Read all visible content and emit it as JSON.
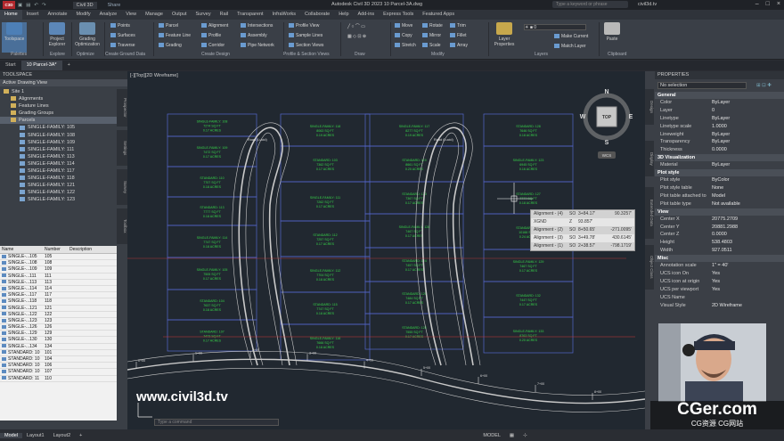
{
  "app": {
    "title": "Autodesk Civil 3D 2023    10 Parcel-3A.dwg",
    "workspace": "Civil 3D",
    "share": "Share",
    "search_placeholder": "Type a keyword or phrase",
    "user": "civil3d.tv"
  },
  "ribbon_tabs": [
    "Home",
    "Insert",
    "Annotate",
    "Modify",
    "Analyze",
    "View",
    "Manage",
    "Output",
    "Survey",
    "Rail",
    "Transparent",
    "InfraWorks",
    "Collaborate",
    "Help",
    "Add-ins",
    "Express Tools",
    "Featured Apps"
  ],
  "ribbon": {
    "toolspace": "Toolspace",
    "project_explorer": "Project Explorer",
    "grading_opt": "Grading Optimization",
    "points": "Points",
    "surfaces": "Surfaces",
    "traverse": "Traverse",
    "parcel": "Parcel",
    "feature_line": "Feature Line",
    "grading": "Grading",
    "alignment": "Alignment",
    "profile": "Profile",
    "corridor": "Corridor",
    "intersections": "Intersections",
    "assembly": "Assembly",
    "pipe_network": "Pipe Network",
    "profile_view": "Profile View",
    "sample_lines": "Sample Lines",
    "section_views": "Section Views",
    "move": "Move",
    "copy": "Copy",
    "stretch": "Stretch",
    "rotate": "Rotate",
    "mirror": "Mirror",
    "scale": "Scale",
    "trim": "Trim",
    "fillet": "Fillet",
    "array": "Array",
    "layer_properties": "Layer Properties",
    "make_current": "Make Current",
    "match_layer": "Match Layer",
    "paste": "Paste",
    "panels": [
      "Palettes",
      "Explore",
      "Optimize",
      "Create Ground Data",
      "Create Design",
      "Profile & Section Views",
      "Draw",
      "Modify",
      "Layers",
      "Clipboard"
    ]
  },
  "doc_tabs": [
    "Start",
    "10 Parcel-3A*"
  ],
  "toolspace": {
    "title": "TOOLSPACE",
    "view": "Active Drawing View",
    "tree": [
      "Site 1",
      "Alignments",
      "Feature Lines",
      "Grading Groups",
      "Parcels",
      "SINGLE-FAMILY: 105",
      "SINGLE-FAMILY: 108",
      "SINGLE-FAMILY: 109",
      "SINGLE-FAMILY: 111",
      "SINGLE-FAMILY: 113",
      "SINGLE-FAMILY: 114",
      "SINGLE-FAMILY: 117",
      "SINGLE-FAMILY: 118",
      "SINGLE-FAMILY: 121",
      "SINGLE-FAMILY: 122",
      "SINGLE-FAMILY: 123"
    ],
    "side_tabs": [
      "Prospector",
      "Settings",
      "Survey",
      "Toolbox"
    ]
  },
  "list": {
    "headers": [
      "Name",
      "Number",
      "Description"
    ],
    "rows": [
      [
        "SINGLE-...105",
        "105"
      ],
      [
        "SINGLE-...108",
        "108"
      ],
      [
        "SINGLE-...109",
        "109"
      ],
      [
        "SINGLE-...111",
        "111"
      ],
      [
        "SINGLE-...113",
        "113"
      ],
      [
        "SINGLE-...114",
        "114"
      ],
      [
        "SINGLE-...117",
        "117"
      ],
      [
        "SINGLE-...118",
        "118"
      ],
      [
        "SINGLE-...121",
        "121"
      ],
      [
        "SINGLE-...122",
        "122"
      ],
      [
        "SINGLE-...123",
        "123"
      ],
      [
        "SINGLE-...126",
        "126"
      ],
      [
        "SINGLE-...129",
        "129"
      ],
      [
        "SINGLE-...130",
        "130"
      ],
      [
        "SINGLE-...134",
        "134"
      ],
      [
        "STANDARD: 10",
        "101"
      ],
      [
        "STANDARD: 10",
        "104"
      ],
      [
        "STANDARD: 10",
        "106"
      ],
      [
        "STANDARD: 10",
        "107"
      ],
      [
        "STANDARD: 11",
        "110"
      ]
    ]
  },
  "viewport": {
    "label": "[-][Top][2D Wireframe]",
    "compass": {
      "n": "N",
      "s": "S",
      "e": "E",
      "w": "W",
      "top": "TOP"
    },
    "ucs": "WCS",
    "command_placeholder": "Type a command",
    "tooltip": [
      [
        "Alignment - (4)",
        "SO",
        "3+84.17'",
        "90.3257'"
      ],
      [
        "XGND",
        "Z",
        "93.857'",
        ""
      ],
      [
        "Alignment - (2)",
        "SO",
        "8+50.65'",
        "-271.0095'"
      ],
      [
        "Alignment - (3)",
        "SO",
        "3+49.78'",
        "430.6145'"
      ],
      [
        "Alignment - (1)",
        "SO",
        "2+38.57'",
        "-798.1719'"
      ]
    ]
  },
  "parcels": [
    {
      "l1": "SINGLE-FAMILY: 108",
      "l2": "7274 SQ FT",
      "l3": "0.17 ACRES"
    },
    {
      "l1": "SINGLE-FAMILY: 109",
      "l2": "7472 SQ FT",
      "l3": "0.17 ACRES"
    },
    {
      "l1": "STANDARD: 110",
      "l2": "7707 SQ FT",
      "l3": "0.18 ACRES"
    },
    {
      "l1": "STANDARD: 113",
      "l2": "7777 SQ FT",
      "l3": "0.18 ACRES"
    },
    {
      "l1": "SINGLE-FAMILY: 114",
      "l2": "7747 SQ FT",
      "l3": "0.18 ACRES"
    },
    {
      "l1": "SINGLE-FAMILY: 105",
      "l2": "7505 SQ FT",
      "l3": "0.17 ACRES"
    },
    {
      "l1": "STANDARD: 104",
      "l2": "7637 SQ FT",
      "l3": "0.18 ACRES"
    },
    {
      "l1": "STANDARD: 107",
      "l2": "7473 SQ FT",
      "l3": "0.17 ACRES"
    },
    {
      "l1": "SINGLE-FAMILY: 118",
      "l2": "8063 SQ FT",
      "l3": "0.19 ACRES"
    },
    {
      "l1": "STANDARD: 103",
      "l2": "7362 SQ FT",
      "l3": "0.17 ACRES"
    },
    {
      "l1": "SINGLE-FAMILY: 111",
      "l2": "7262 SQ FT",
      "l3": "0.17 ACRES"
    },
    {
      "l1": "STANDARD: 112",
      "l2": "7257 SQ FT",
      "l3": "0.17 ACRES"
    },
    {
      "l1": "SINGLE-FAMILY: 112",
      "l2": "7704 SQ FT",
      "l3": "0.18 ACRES"
    },
    {
      "l1": "STANDARD: 115",
      "l2": "7747 SQ FT",
      "l3": "0.18 ACRES"
    },
    {
      "l1": "SINGLE-FAMILY: 116",
      "l2": "7666 SQ FT",
      "l3": "0.18 ACRES"
    },
    {
      "l1": "SINGLE-FAMILY: 117",
      "l2": "8277 SQ FT",
      "l3": "0.19 ACRES"
    },
    {
      "l1": "STANDARD: 119",
      "l2": "8661 SQ FT",
      "l3": "0.20 ACRES"
    },
    {
      "l1": "STANDARD: 130",
      "l2": "7367 SQ FT",
      "l3": "0.17 ACRES"
    },
    {
      "l1": "SINGLE-FAMILY: 126",
      "l2": "7467 SQ FT",
      "l3": "0.17 ACRES"
    },
    {
      "l1": "STANDARD: 124",
      "l2": "7457 SQ FT",
      "l3": "0.17 ACRES"
    },
    {
      "l1": "STANDARD: 120",
      "l2": "7484 SQ FT",
      "l3": "0.17 ACRES"
    },
    {
      "l1": "STANDARD: 125",
      "l2": "7555 SQ FT",
      "l3": "0.17 ACRES"
    },
    {
      "l1": "STANDARD: 128",
      "l2": "7646 SQ FT",
      "l3": "0.18 ACRES"
    },
    {
      "l1": "SINGLE-FAMILY: 123",
      "l2": "6945 SQ FT",
      "l3": "0.16 ACRES"
    },
    {
      "l1": "STANDARD: 127",
      "l2": "7777 SQ FT",
      "l3": "0.18 ACRES"
    },
    {
      "l1": "STANDARD: 131",
      "l2": "10166 SQ FT",
      "l3": "0.24 ACRES"
    },
    {
      "l1": "SINGLE-FAMILY: 129",
      "l2": "7467 SQ FT",
      "l3": "0.17 ACRES"
    },
    {
      "l1": "STANDARD: 132",
      "l2": "7447 SQ FT",
      "l3": "0.17 ACRES"
    },
    {
      "l1": "SINGLE-FAMILY: 133",
      "l2": "8763 SQ FT",
      "l3": "0.20 ACRES"
    },
    {
      "l1": "STANDARD: 133",
      "l2": "7507 SQ FT",
      "l3": "0.17 ACRES"
    },
    {
      "l1": "STANDARD: 134",
      "l2": "7347 SQ FT",
      "l3": "0.17 ACRES"
    },
    {
      "l1": "STANDARD: 135",
      "l2": "7340 SQ FT",
      "l3": "0.17 ACRES"
    },
    {
      "l1": "STANDARD: 137",
      "l2": "7337 SQ FT",
      "l3": "0.17 ACRES"
    },
    {
      "l1": "SINGLE-FAMILY: 134",
      "l2": "8340 SQ FT",
      "l3": "0.19 ACRES"
    },
    {
      "l1": "STANDARD: 136",
      "l2": "9226 SQ FT",
      "l3": "0.21 ACRES"
    }
  ],
  "road_labels": [
    "Road (Lucid)",
    "Road (Lucid)"
  ],
  "stations": [
    "0+00",
    "1+00",
    "2+00",
    "3+00",
    "4+00",
    "5+00",
    "6+00",
    "7+00",
    "8+00"
  ],
  "watermark": "www.civil3d.tv",
  "properties": {
    "title": "PROPERTIES",
    "selection": "No selection",
    "sections": [
      {
        "name": "General",
        "rows": [
          [
            "Color",
            "ByLayer"
          ],
          [
            "Layer",
            "0"
          ],
          [
            "Linetype",
            "ByLayer"
          ],
          [
            "Linetype scale",
            "1.0000"
          ],
          [
            "Lineweight",
            "ByLayer"
          ],
          [
            "Transparency",
            "ByLayer"
          ],
          [
            "Thickness",
            "0.0000"
          ]
        ]
      },
      {
        "name": "3D Visualization",
        "rows": [
          [
            "Material",
            "ByLayer"
          ]
        ]
      },
      {
        "name": "Plot style",
        "rows": [
          [
            "Plot style",
            "ByColor"
          ],
          [
            "Plot style table",
            "None"
          ],
          [
            "Plot table attached to",
            "Model"
          ],
          [
            "Plot table type",
            "Not available"
          ]
        ]
      },
      {
        "name": "View",
        "rows": [
          [
            "Center X",
            "20775.2709"
          ],
          [
            "Center Y",
            "20881.2988"
          ],
          [
            "Center Z",
            "0.0000"
          ],
          [
            "Height",
            "538.4803"
          ],
          [
            "Width",
            "927.0511"
          ]
        ]
      },
      {
        "name": "Misc",
        "rows": [
          [
            "Annotation scale",
            "1\" = 40'"
          ],
          [
            "UCS icon On",
            "Yes"
          ],
          [
            "UCS icon at origin",
            "Yes"
          ],
          [
            "UCS per viewport",
            "Yes"
          ],
          [
            "UCS Name",
            ""
          ],
          [
            "Visual Style",
            "2D Wireframe"
          ]
        ]
      }
    ],
    "side_tabs": [
      "Design",
      "Display",
      "Extended Data",
      "Object Class"
    ]
  },
  "brand": {
    "big": "CGer.com",
    "small": "CG资源 CG网站"
  },
  "layout_tabs": [
    "Model",
    "Layout1",
    "Layout2"
  ],
  "status_right": "MODEL",
  "colors": {
    "parcel_line": "#5566cc",
    "label": "#37d64a",
    "road": "#c9c9c9",
    "alignment_red": "#d03a3a",
    "bg": "#212830"
  }
}
